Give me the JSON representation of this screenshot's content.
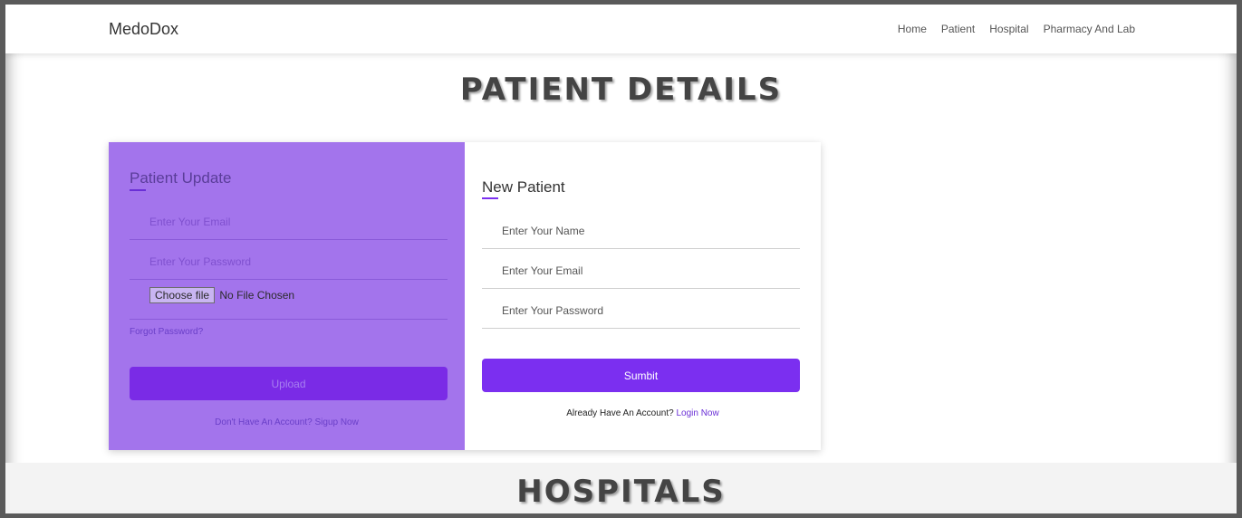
{
  "nav": {
    "brand": "MedoDox",
    "links": [
      "Home",
      "Patient",
      "Hospital",
      "Pharmacy And Lab"
    ]
  },
  "patient_section": {
    "title": "PATIENT DETAILS"
  },
  "update_panel": {
    "heading": "Patient Update",
    "email_placeholder": "Enter Your Email",
    "password_placeholder": "Enter Your Password",
    "file_button": "Choose file",
    "file_status": "No File Chosen",
    "forgot": "Forgot Password?",
    "upload_label": "Upload",
    "footer_text": "Don't Have An Account?",
    "footer_link": "Sigup Now"
  },
  "new_panel": {
    "heading": "New Patient",
    "name_placeholder": "Enter Your Name",
    "email_placeholder": "Enter Your Email",
    "password_placeholder": "Enter Your Password",
    "submit_label": "Sumbit",
    "footer_text": "Already Have An Account?",
    "footer_link": "Login Now"
  },
  "hospitals_section": {
    "title": "HOSPITALS"
  },
  "colors": {
    "accent": "#7b2ff0",
    "panel": "#a374ec"
  }
}
